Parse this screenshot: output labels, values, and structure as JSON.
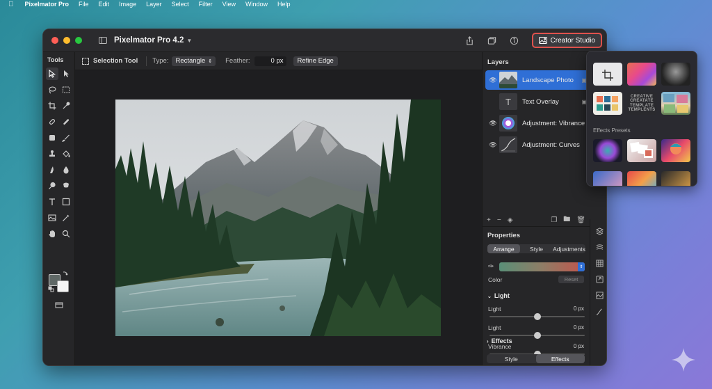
{
  "menubar": {
    "apple_icon": "apple-icon",
    "app_name": "Pixelmator Pro",
    "items": [
      "File",
      "Edit",
      "Image",
      "Layer",
      "Select",
      "Filter",
      "View",
      "Window",
      "Help"
    ]
  },
  "window": {
    "title": "Pixelmator Pro 4.2",
    "creator_button": "Creator Studio"
  },
  "tools": {
    "title": "Tools",
    "foreground_color": "#5f6866",
    "background_color": "#f5f5f5"
  },
  "options": {
    "tool_name": "Selection Tool",
    "type_label": "Type:",
    "type_value": "Rectangle",
    "feather_label": "Feather:",
    "feather_value": "0 px",
    "refine_button": "Refine Edge"
  },
  "layers": {
    "title": "Layers",
    "items": [
      {
        "name": "Landscape Photo",
        "selected": true
      },
      {
        "name": "Text Overlay",
        "selected": false
      },
      {
        "name": "Adjustment: Vibrance",
        "selected": false
      },
      {
        "name": "Adjustment: Curves",
        "selected": false
      }
    ]
  },
  "properties": {
    "title": "Properties",
    "tabs": [
      "Arrange",
      "Style",
      "Adjustments"
    ],
    "active_tab": "Arrange",
    "color_label": "Color",
    "reset_label": "Reset",
    "light_section": "Light",
    "sliders": [
      {
        "label": "Light",
        "value": "0 px",
        "level": 0.5
      },
      {
        "label": "Light",
        "value": "0 px",
        "level": 0.5
      },
      {
        "label": "Vibrance",
        "value": "0 px",
        "level": 0.5
      }
    ],
    "effects_section": "Effects",
    "bottom_tabs": [
      "Style",
      "Effects"
    ],
    "bottom_active": "Effects"
  },
  "popover": {
    "effects_presets_label": "Effects Presets",
    "template_text": "CREATIVE CREATATE TEMPLATE TEMPLENTS"
  },
  "colors": {
    "accent": "#2f6fd6",
    "highlight_border": "#e0524d"
  }
}
